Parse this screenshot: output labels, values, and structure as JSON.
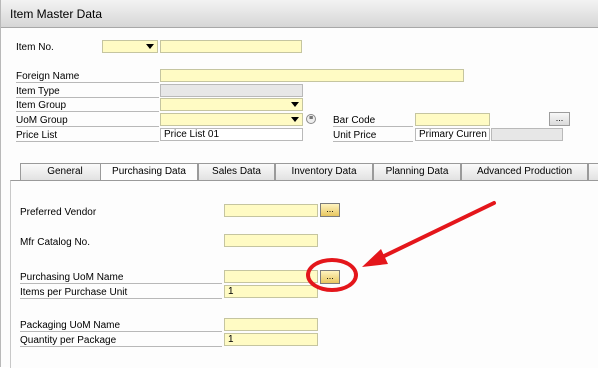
{
  "window": {
    "title": "Item Master Data"
  },
  "header": {
    "item_no_label": "Item No.",
    "foreign_name_label": "Foreign Name",
    "item_type_label": "Item Type",
    "item_group_label": "Item Group",
    "uom_group_label": "UoM Group",
    "price_list_label": "Price List",
    "price_list_value": "Price List 01",
    "bar_code_label": "Bar Code",
    "unit_price_label": "Unit Price",
    "unit_price_currency": "Primary Curren",
    "browse_label": "..."
  },
  "tabs": [
    {
      "label": "General"
    },
    {
      "label": "Purchasing Data"
    },
    {
      "label": "Sales Data"
    },
    {
      "label": "Inventory Data"
    },
    {
      "label": "Planning Data"
    },
    {
      "label": "Advanced Production"
    }
  ],
  "purchasing": {
    "preferred_vendor_label": "Preferred Vendor",
    "mfr_catalog_label": "Mfr Catalog No.",
    "purchasing_uom_label": "Purchasing UoM Name",
    "items_per_unit_label": "Items per Purchase Unit",
    "items_per_unit_value": "1",
    "packaging_uom_label": "Packaging UoM Name",
    "qty_per_package_label": "Quantity per Package",
    "qty_per_package_value": "1",
    "browse_label": "..."
  },
  "colors": {
    "annotation": "#e4161b",
    "field_bg": "#fffbc4"
  }
}
